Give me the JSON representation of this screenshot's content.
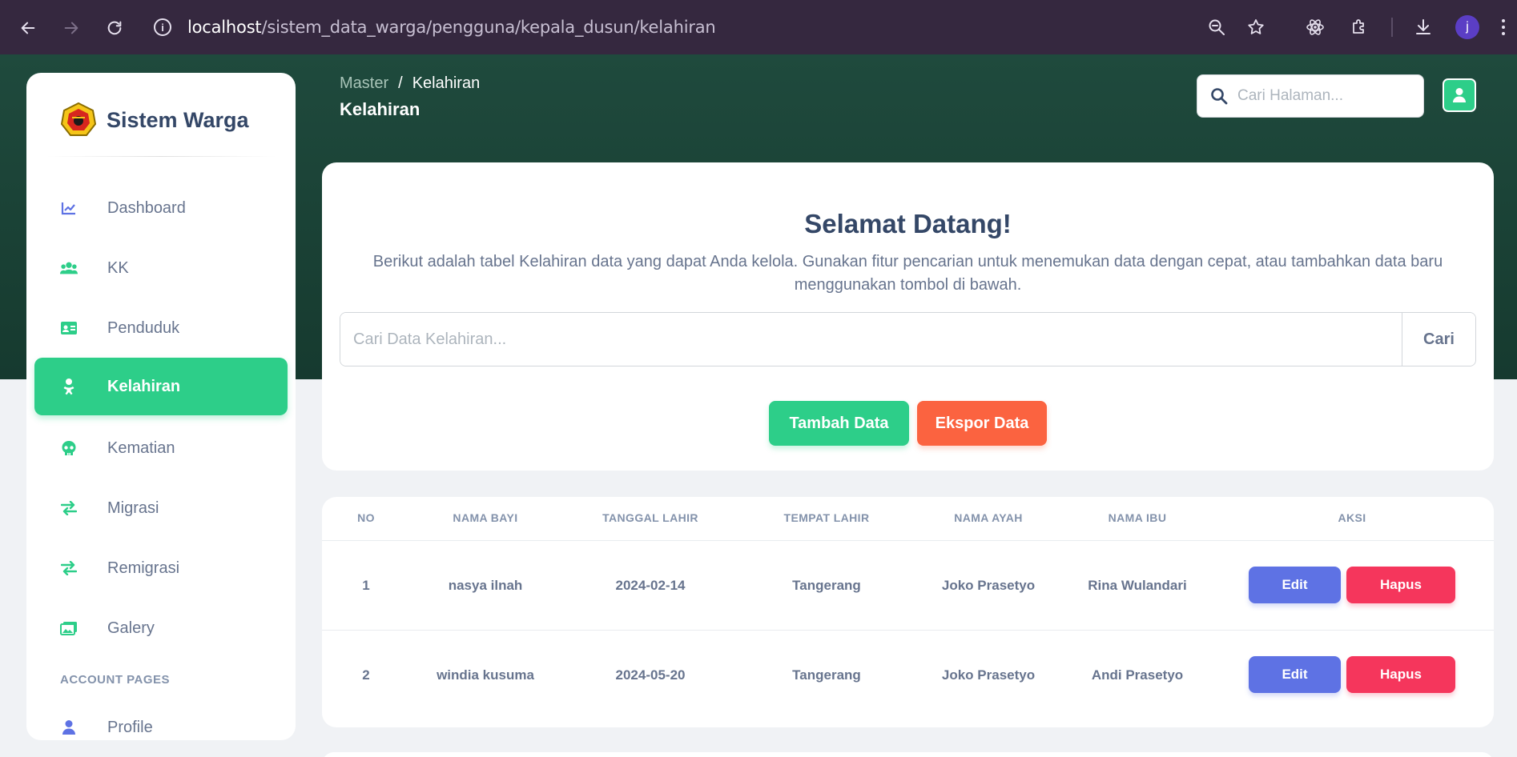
{
  "browser": {
    "url_host": "localhost",
    "url_path": "/sistem_data_warga/pengguna/kepala_dusun/kelahiran",
    "profile_initial": "j"
  },
  "sidebar": {
    "brand": "Sistem Warga",
    "items": [
      {
        "label": "Dashboard",
        "icon": "chart-line-icon"
      },
      {
        "label": "KK",
        "icon": "users-icon"
      },
      {
        "label": "Penduduk",
        "icon": "id-card-icon"
      },
      {
        "label": "Kelahiran",
        "icon": "baby-icon",
        "active": true
      },
      {
        "label": "Kematian",
        "icon": "skull-icon"
      },
      {
        "label": "Migrasi",
        "icon": "exchange-icon"
      },
      {
        "label": "Remigrasi",
        "icon": "exchange-icon"
      },
      {
        "label": "Galery",
        "icon": "images-icon"
      }
    ],
    "section_label": "ACCOUNT PAGES",
    "account_items": [
      {
        "label": "Profile",
        "icon": "user-icon"
      }
    ]
  },
  "header": {
    "breadcrumb_parent": "Master",
    "breadcrumb_sep": "/",
    "breadcrumb_current": "Kelahiran",
    "title": "Kelahiran",
    "search_placeholder": "Cari Halaman..."
  },
  "welcome": {
    "title": "Selamat Datang!",
    "description": "Berikut adalah tabel Kelahiran data yang dapat Anda kelola. Gunakan fitur pencarian untuk menemukan data dengan cepat, atau tambahkan data baru menggunakan tombol di bawah.",
    "search_placeholder": "Cari Data Kelahiran...",
    "search_button": "Cari",
    "add_button": "Tambah Data",
    "export_button": "Ekspor Data"
  },
  "table": {
    "columns": [
      "NO",
      "NAMA BAYI",
      "TANGGAL LAHIR",
      "TEMPAT LAHIR",
      "NAMA AYAH",
      "NAMA IBU",
      "AKSI"
    ],
    "rows": [
      {
        "no": "1",
        "nama_bayi": "nasya ilnah",
        "tanggal_lahir": "2024-02-14",
        "tempat_lahir": "Tangerang",
        "nama_ayah": "Joko Prasetyo",
        "nama_ibu": "Rina Wulandari"
      },
      {
        "no": "2",
        "nama_bayi": "windia kusuma",
        "tanggal_lahir": "2024-05-20",
        "tempat_lahir": "Tangerang",
        "nama_ayah": "Joko Prasetyo",
        "nama_ibu": "Andi Prasetyo"
      }
    ],
    "edit_label": "Edit",
    "delete_label": "Hapus"
  },
  "colors": {
    "primary_green": "#2dce89",
    "header_green": "#1f4a3d",
    "edit_blue": "#5e72e4",
    "delete_red": "#f5365c",
    "export_orange": "#fb6340"
  }
}
